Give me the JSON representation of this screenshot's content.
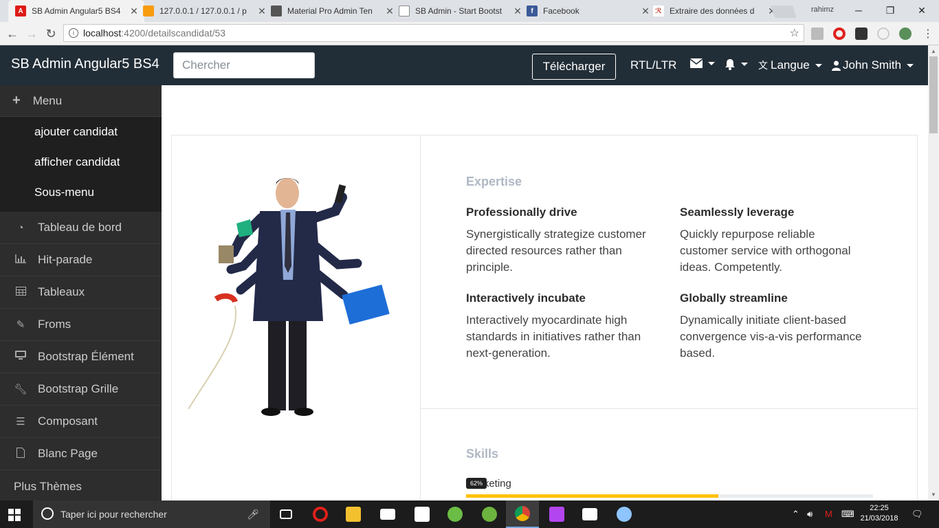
{
  "browser": {
    "tabs": [
      {
        "title": "SB Admin Angular5 BS4",
        "favicon_color": "#dd1b16",
        "active": true
      },
      {
        "title": "127.0.0.1 / 127.0.0.1 / p",
        "favicon_color": "#f89c0e"
      },
      {
        "title": "Material Pro Admin Ten",
        "favicon_color": "#555555"
      },
      {
        "title": "SB Admin - Start Bootst",
        "favicon_color": "#888888"
      },
      {
        "title": "Facebook",
        "favicon_color": "#3b5998"
      },
      {
        "title": "Extraire des données d",
        "favicon_color": "#c0392b"
      }
    ],
    "profile_name": "rahimz",
    "url_host": "localhost",
    "url_path": ":4200/detailscandidat/53"
  },
  "navbar": {
    "brand": "SB Admin Angular5 BS4",
    "search_placeholder": "Chercher",
    "download_label": "Télécharger",
    "rtl_label": "RTL/LTR",
    "language_label": "Langue",
    "user_label": "John Smith"
  },
  "sidebar": {
    "menu_label": "Menu",
    "submenu": [
      "ajouter candidat",
      "afficher candidat",
      "Sous-menu"
    ],
    "items": [
      {
        "label": "Tableau de bord",
        "icon": "dashboard-icon"
      },
      {
        "label": "Hit-parade",
        "icon": "bar-chart-icon"
      },
      {
        "label": "Tableaux",
        "icon": "table-icon"
      },
      {
        "label": "Froms",
        "icon": "edit-icon"
      },
      {
        "label": "Bootstrap Élément",
        "icon": "desktop-icon"
      },
      {
        "label": "Bootstrap Grille",
        "icon": "wrench-icon"
      },
      {
        "label": "Composant",
        "icon": "list-icon"
      },
      {
        "label": "Blanc Page",
        "icon": "file-icon"
      },
      {
        "label": "Plus Thèmes",
        "icon": ""
      }
    ]
  },
  "profile": {
    "expertise_title": "Expertise",
    "expertise": [
      {
        "title": "Professionally drive",
        "text": "Synergistically strategize customer directed resources rather than principle."
      },
      {
        "title": "Seamlessly leverage",
        "text": "Quickly repurpose reliable customer service with orthogonal ideas. Competently."
      },
      {
        "title": "Interactively incubate",
        "text": "Interactively myocardinate high standards in initiatives rather than next-generation."
      },
      {
        "title": "Globally streamline",
        "text": "Dynamically initiate client-based convergence vis-a-vis performance based."
      }
    ],
    "skills_title": "Skills",
    "skill": {
      "label": "Marketing",
      "badge": "62%",
      "value": 0.62,
      "color": "#ffc107"
    }
  },
  "taskbar": {
    "search_placeholder": "Taper ici pour rechercher",
    "time": "22:25",
    "date": "21/03/2018"
  }
}
